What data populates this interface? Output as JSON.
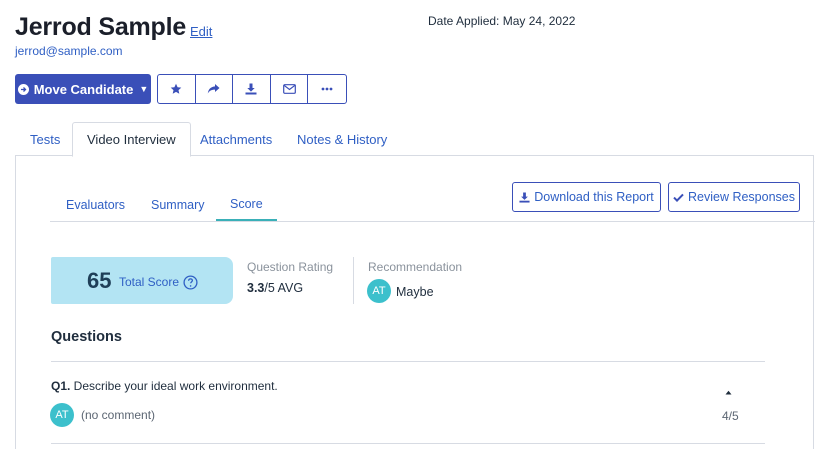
{
  "candidate": {
    "name": "Jerrod Sample",
    "edit_label": "Edit",
    "email": "jerrod@sample.com",
    "date_applied": "Date Applied: May 24, 2022"
  },
  "toolbar": {
    "move_label": "Move Candidate",
    "icons": [
      "star-icon",
      "share-icon",
      "download-icon",
      "email-icon",
      "more-icon"
    ]
  },
  "main_tabs": [
    {
      "label": "Tests",
      "active": false
    },
    {
      "label": "Video Interview",
      "active": true
    },
    {
      "label": "Attachments",
      "active": false
    },
    {
      "label": "Notes & History",
      "active": false
    }
  ],
  "sub_tabs": [
    {
      "label": "Evaluators",
      "active": false
    },
    {
      "label": "Summary",
      "active": false
    },
    {
      "label": "Score",
      "active": true
    }
  ],
  "actions": {
    "download_label": "Download this Report",
    "review_label": "Review Responses"
  },
  "score": {
    "total": "65",
    "total_label": "Total Score",
    "rating_label": "Question Rating",
    "rating_value": "3.3",
    "rating_suffix": "/5 AVG",
    "recommendation_label": "Recommendation",
    "recommendation_initials": "AT",
    "recommendation_value": "Maybe"
  },
  "questions": {
    "title": "Questions",
    "items": [
      {
        "number": "Q1.",
        "text": " Describe your ideal work environment.",
        "evaluator_initials": "AT",
        "comment": "(no comment)",
        "score": "4/5"
      }
    ]
  },
  "colors": {
    "primary": "#3a4fb8",
    "link": "#2f5fc4",
    "teal": "#3cc0cc",
    "score_bg": "#b3e4f3"
  }
}
